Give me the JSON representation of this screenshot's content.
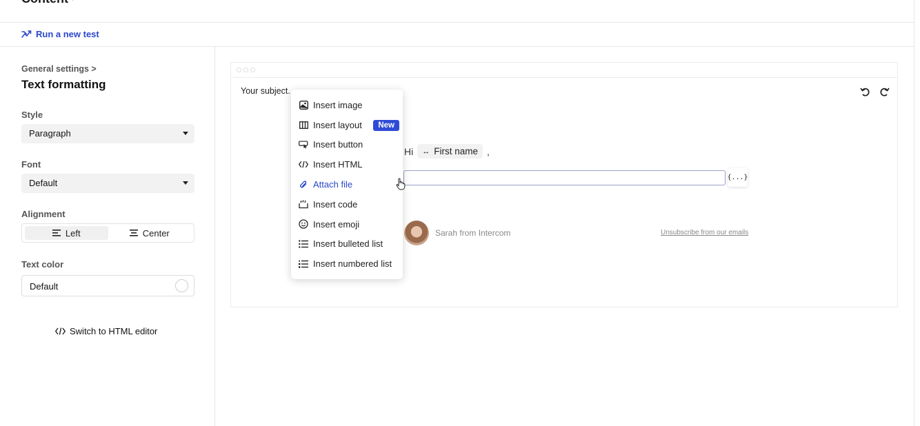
{
  "header": {
    "title": "Content"
  },
  "test_bar": {
    "run_test_label": "Run a new test"
  },
  "sidebar": {
    "breadcrumb": "General settings >",
    "title": "Text formatting",
    "style": {
      "label": "Style",
      "value": "Paragraph"
    },
    "font": {
      "label": "Font",
      "value": "Default"
    },
    "alignment": {
      "label": "Alignment",
      "left": "Left",
      "center": "Center",
      "selected": "Left"
    },
    "text_color": {
      "label": "Text color",
      "value": "Default"
    },
    "switch_html": "Switch to HTML editor"
  },
  "editor": {
    "subject_placeholder": "Your subject..",
    "greeting": "Hi",
    "attribute": "First name",
    "comma": ",",
    "attr_button": "{...}",
    "sender": "Sarah from Intercom",
    "unsubscribe": "Unsubscribe from our emails"
  },
  "insert_menu": {
    "items": [
      {
        "label": "Insert image",
        "icon": "image-icon"
      },
      {
        "label": "Insert layout",
        "icon": "layout-icon",
        "badge": "New"
      },
      {
        "label": "Insert button",
        "icon": "button-icon"
      },
      {
        "label": "Insert HTML",
        "icon": "code-icon"
      },
      {
        "label": "Attach file",
        "icon": "paperclip-icon"
      },
      {
        "label": "Insert code",
        "icon": "code-block-icon"
      },
      {
        "label": "Insert emoji",
        "icon": "emoji-icon"
      },
      {
        "label": "Insert bulleted list",
        "icon": "bulleted-list-icon"
      },
      {
        "label": "Insert numbered list",
        "icon": "numbered-list-icon"
      }
    ],
    "hovered_index": 4
  },
  "colors": {
    "accent": "#2b47c9",
    "badge": "#2f4bd6",
    "border": "#e6e6e6"
  }
}
